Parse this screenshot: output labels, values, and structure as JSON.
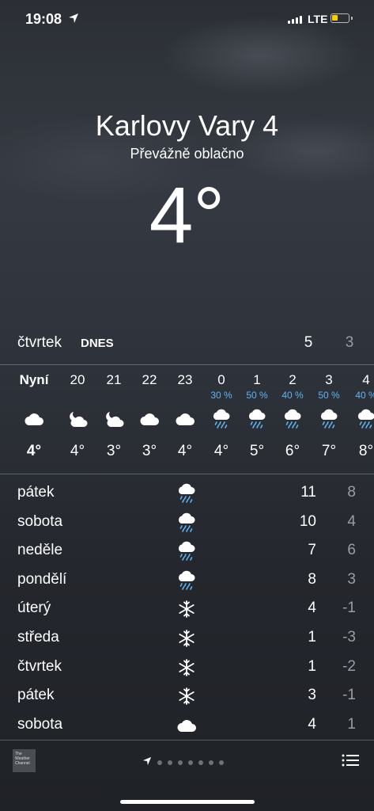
{
  "status_bar": {
    "time": "19:08",
    "network": "LTE"
  },
  "location": {
    "city": "Karlovy Vary 4",
    "condition": "Převážně oblačno",
    "temperature": "4°"
  },
  "today": {
    "day": "čtvrtek",
    "tag": "DNES",
    "high": "5",
    "low": "3"
  },
  "hourly": [
    {
      "time": "Nyní",
      "precip": "",
      "icon": "cloud-icon",
      "temp": "4°"
    },
    {
      "time": "20",
      "precip": "",
      "icon": "partly-cloudy-night-icon",
      "temp": "4°"
    },
    {
      "time": "21",
      "precip": "",
      "icon": "partly-cloudy-night-icon",
      "temp": "3°"
    },
    {
      "time": "22",
      "precip": "",
      "icon": "cloud-icon",
      "temp": "3°"
    },
    {
      "time": "23",
      "precip": "",
      "icon": "cloud-icon",
      "temp": "4°"
    },
    {
      "time": "0",
      "precip": "30 %",
      "icon": "rain-cloud-icon",
      "temp": "4°"
    },
    {
      "time": "1",
      "precip": "50 %",
      "icon": "rain-cloud-icon",
      "temp": "5°"
    },
    {
      "time": "2",
      "precip": "40 %",
      "icon": "rain-cloud-icon",
      "temp": "6°"
    },
    {
      "time": "3",
      "precip": "50 %",
      "icon": "rain-cloud-icon",
      "temp": "7°"
    },
    {
      "time": "4",
      "precip": "40 %",
      "icon": "rain-cloud-icon",
      "temp": "8°"
    }
  ],
  "daily": [
    {
      "day": "pátek",
      "icon": "rain-cloud-icon",
      "high": "11",
      "low": "8"
    },
    {
      "day": "sobota",
      "icon": "rain-cloud-icon",
      "high": "10",
      "low": "4"
    },
    {
      "day": "neděle",
      "icon": "rain-cloud-icon",
      "high": "7",
      "low": "6"
    },
    {
      "day": "pondělí",
      "icon": "rain-cloud-icon",
      "high": "8",
      "low": "3"
    },
    {
      "day": "úterý",
      "icon": "snowflake-icon",
      "high": "4",
      "low": "-1"
    },
    {
      "day": "středa",
      "icon": "snowflake-icon",
      "high": "1",
      "low": "-3"
    },
    {
      "day": "čtvrtek",
      "icon": "snowflake-icon",
      "high": "1",
      "low": "-2"
    },
    {
      "day": "pátek",
      "icon": "snowflake-icon",
      "high": "3",
      "low": "-1"
    },
    {
      "day": "sobota",
      "icon": "cloud-icon",
      "high": "4",
      "low": "1"
    }
  ],
  "footer": {
    "provider_logo": "The Weather Channel",
    "page_count": 8
  },
  "colors": {
    "precip": "#5fb4ef",
    "low_temp": "#9a9da3",
    "battery": "#f5d000"
  }
}
